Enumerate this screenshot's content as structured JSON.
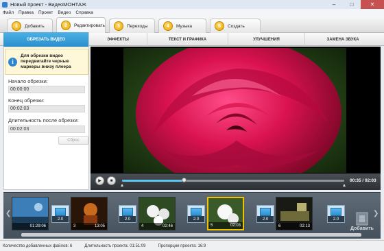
{
  "window": {
    "title": "Новый проект - ВидеоМОНТАЖ"
  },
  "menu": [
    "Файл",
    "Правка",
    "Проект",
    "Видео",
    "Справка"
  ],
  "steps": [
    {
      "num": "1",
      "label": "Добавить"
    },
    {
      "num": "2",
      "label": "Редактировать"
    },
    {
      "num": "3",
      "label": "Переходы"
    },
    {
      "num": "4",
      "label": "Музыка"
    },
    {
      "num": "5",
      "label": "Создать"
    }
  ],
  "subtabs": [
    "ОБРЕЗАТЬ ВИДЕО",
    "ЭФФЕКТЫ",
    "ТЕКСТ И ГРАФИКА",
    "УЛУЧШЕНИЯ",
    "ЗАМЕНА ЗВУКА"
  ],
  "trim": {
    "hint": "Для обрезки видео передвигайте черные маркеры внизу плеера",
    "start_label": "Начало обрезки:",
    "start_value": "00:00:00",
    "end_label": "Конец обрезки:",
    "end_value": "00:02:03",
    "duration_label": "Длительность после обрезки:",
    "duration_value": "00:02:03",
    "reset_label": "Сброс"
  },
  "player": {
    "time": "00:35 / 02:03",
    "progress": 0.28
  },
  "timeline": {
    "clips": [
      {
        "num": "",
        "duration": "01:29:06"
      },
      {
        "num": "3",
        "duration": "13:05"
      },
      {
        "num": "4",
        "duration": "02:46"
      },
      {
        "num": "5",
        "duration": "02:03"
      },
      {
        "num": "6",
        "duration": "02:13"
      }
    ],
    "transitions": [
      "2.0",
      "2.0",
      "2.0",
      "2.0",
      "2.0"
    ],
    "add_label": "Добавить"
  },
  "status": {
    "files": "Количество добавленных файлов: 6",
    "duration": "Длительность проекта: 01:51:09",
    "ratio": "Пропорции проекта: 16:9"
  },
  "colors": {
    "accent": "#2a8fcc",
    "selected_clip": "#f0c200"
  }
}
